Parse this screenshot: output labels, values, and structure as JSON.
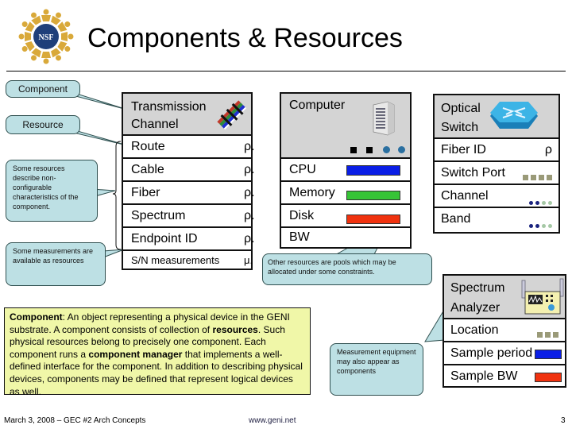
{
  "slide": {
    "title": "Components & Resources",
    "logo_text": "NSF",
    "page_number": "3"
  },
  "callouts": {
    "component": "Component",
    "resource": "Resource",
    "non_configurable": "Some resources describe non-configurable characteristics of the component.",
    "measurements": "Some measurements are available as resources",
    "pools": "Other resources are pools which may be allocated under some constraints.",
    "measurement_equipment": "Measurement equipment may also appear as components"
  },
  "transmission_channel": {
    "title_line1": "Transmission",
    "title_line2": "Channel",
    "icon": "cable-bundle-icon",
    "rows": [
      {
        "label": "Route",
        "symbol": "ρ."
      },
      {
        "label": "Cable",
        "symbol": "ρ."
      },
      {
        "label": "Fiber",
        "symbol": "ρ."
      },
      {
        "label": "Spectrum",
        "symbol": "ρ."
      },
      {
        "label": "Endpoint ID",
        "symbol": "ρ."
      },
      {
        "label": "S/N measurements",
        "symbol": "μ."
      }
    ]
  },
  "computer": {
    "title": "Computer",
    "icon": "server-tower-icon",
    "rows": [
      {
        "label": "CPU",
        "bar_color": "#0a1ee6"
      },
      {
        "label": "Memory",
        "bar_color": "#36c436"
      },
      {
        "label": "Disk",
        "bar_color": "#f0320f"
      },
      {
        "label": "BW",
        "bar_color": ""
      }
    ]
  },
  "optical_switch": {
    "title_line1": "Optical",
    "title_line2": "Switch",
    "icon": "router-switch-icon",
    "rows": [
      {
        "label": "Fiber ID",
        "symbol": "ρ"
      },
      {
        "label": "Switch Port",
        "indicator": "squares"
      },
      {
        "label": "Channel",
        "indicator": "dots"
      },
      {
        "label": "Band",
        "indicator": "dots"
      }
    ]
  },
  "spectrum_analyzer": {
    "title_line1": "Spectrum",
    "title_line2": "Analyzer",
    "icon": "spectrum-analyzer-icon",
    "rows": [
      {
        "label": "Location",
        "indicator": "squares"
      },
      {
        "label": "Sample period",
        "bar_color": "#0a1ee6"
      },
      {
        "label": "Sample BW",
        "bar_color": "#f0320f"
      }
    ]
  },
  "definition": {
    "term": "Component",
    "part1": ": An object representing a physical device in the GENI substrate. A component consists of collection of ",
    "bold1": "resources",
    "part2": ". Such physical resources belong to precisely one component. Each component runs a ",
    "bold2": "component manager",
    "part3": " that implements a well-defined interface for the component. In addition to describing physical devices, components may be defined that represent logical devices as well."
  },
  "footer": {
    "left": "March 3, 2008 – GEC #2 Arch Concepts",
    "center": "www.geni.net"
  },
  "colors": {
    "callout_fill": "#bde0e4",
    "definition_fill": "#f0f7a8",
    "header_fill": "#d4d4d4",
    "square_gray": "#9a9a78",
    "dot_dark": "#1a237e",
    "dot_light": "#a5c8a5"
  }
}
